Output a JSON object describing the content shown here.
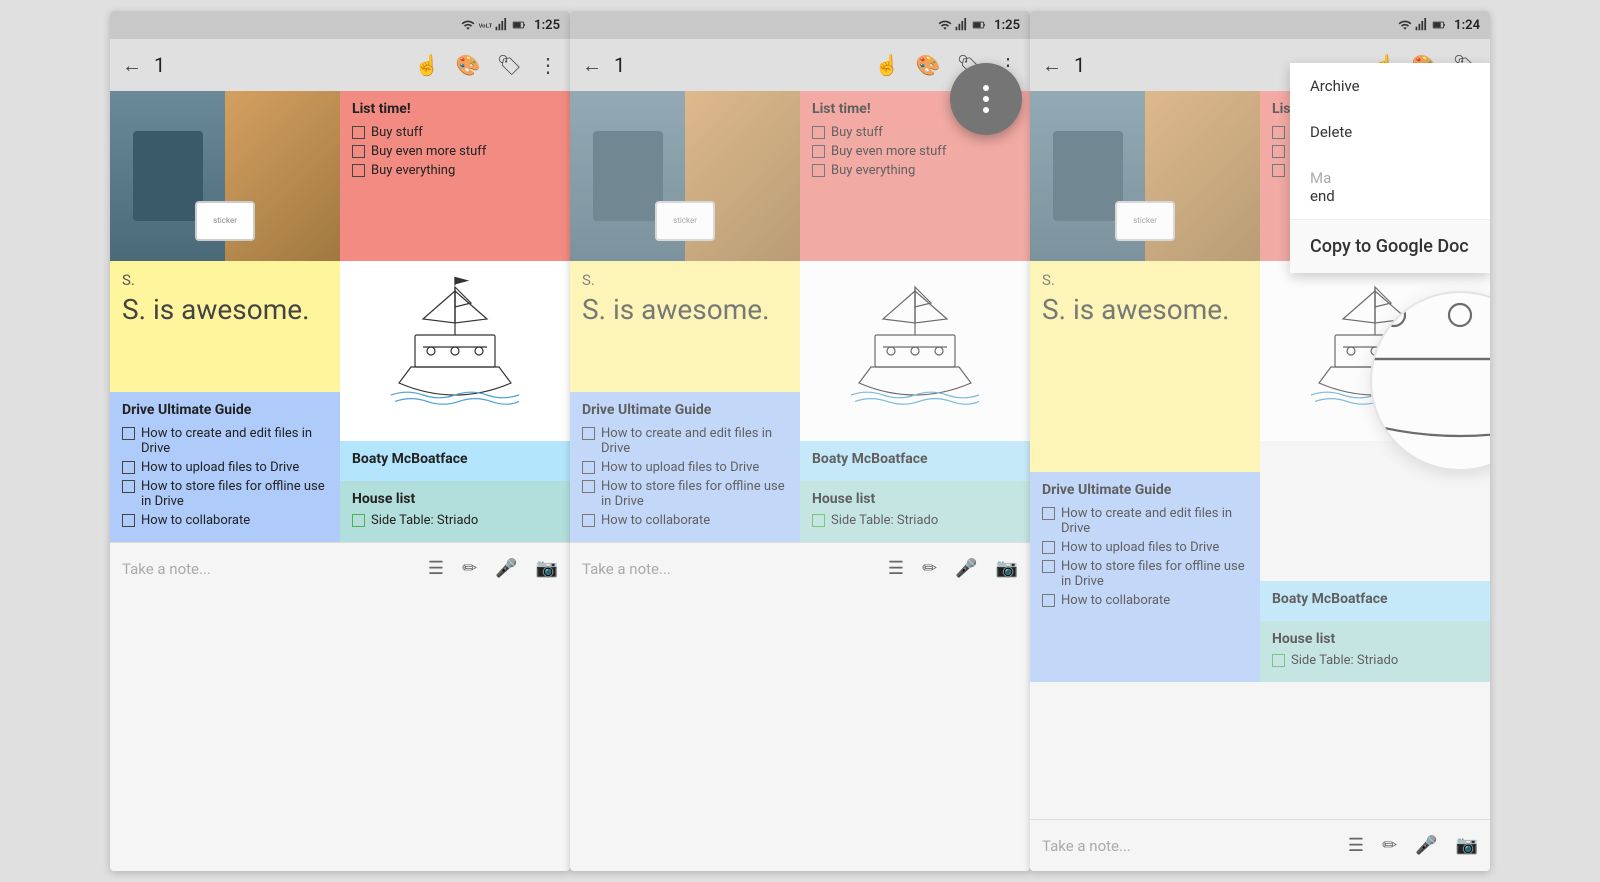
{
  "screens": [
    {
      "id": "screen1",
      "statusBar": {
        "time": "1:25",
        "hasOverlay": false
      },
      "toolbar": {
        "backLabel": "←",
        "count": "1",
        "icons": [
          "fingerprint",
          "palette",
          "label",
          "more"
        ]
      },
      "notes": {
        "col1": {
          "imageNote": {
            "type": "image"
          },
          "yellowNote": {
            "letter": "S.",
            "text": "S. is awesome.",
            "bg": "yellow"
          },
          "blueNote": {
            "title": "Drive Ultimate Guide",
            "items": [
              "How to create and edit files in Drive",
              "How to upload files to Drive",
              "How to store files for offline use in Drive",
              "How to collaborate"
            ]
          }
        },
        "col2": {
          "pinkNote": {
            "title": "List time!",
            "items": [
              "Buy stuff",
              "Buy even more stuff",
              "Buy everything"
            ]
          },
          "shipNote": {
            "type": "ship"
          },
          "boatyNote": {
            "title": "Boaty McBoatface",
            "bg": "lightblue"
          },
          "houseNote": {
            "title": "House list",
            "items": [
              "Side Table: Striado"
            ],
            "bg": "teal"
          }
        }
      },
      "bottomBar": {
        "placeholder": "Take a note...",
        "icons": [
          "list",
          "pencil",
          "mic",
          "camera"
        ]
      }
    },
    {
      "id": "screen2",
      "statusBar": {
        "time": "1:25",
        "hasOverlay": false
      },
      "toolbar": {
        "backLabel": "←",
        "count": "1",
        "icons": [
          "fingerprint",
          "palette",
          "label",
          "more"
        ]
      },
      "fab": {
        "show": true,
        "dots": 3
      },
      "bottomBar": {
        "placeholder": "Take a note...",
        "icons": [
          "list",
          "pencil",
          "mic",
          "camera"
        ]
      }
    },
    {
      "id": "screen3",
      "statusBar": {
        "time": "1:24",
        "hasOverlay": false
      },
      "toolbar": {
        "backLabel": "←",
        "count": "1",
        "icons": [
          "fingerprint",
          "palette",
          "label"
        ]
      },
      "contextMenu": {
        "show": true,
        "items": [
          {
            "label": "Archive",
            "highlighted": false
          },
          {
            "label": "Delete",
            "highlighted": false
          },
          {
            "label": "Make a copy",
            "highlighted": false,
            "partial": "Ma"
          },
          {
            "label": "Send",
            "highlighted": false
          },
          {
            "label": "Copy to Google Doc",
            "highlighted": true
          }
        ]
      },
      "zoomCircle": {
        "show": true
      },
      "bottomBar": {
        "placeholder": "Take a note...",
        "icons": [
          "list",
          "pencil",
          "mic",
          "camera"
        ]
      }
    }
  ],
  "colors": {
    "pink": "#f28b82",
    "yellow": "#fff59d",
    "blue": "#aecbfa",
    "lightblue": "#b3e5fc",
    "teal": "#b2dfdb",
    "statusBar": "#c8c8c8",
    "toolbar": "#e0e0e0"
  }
}
